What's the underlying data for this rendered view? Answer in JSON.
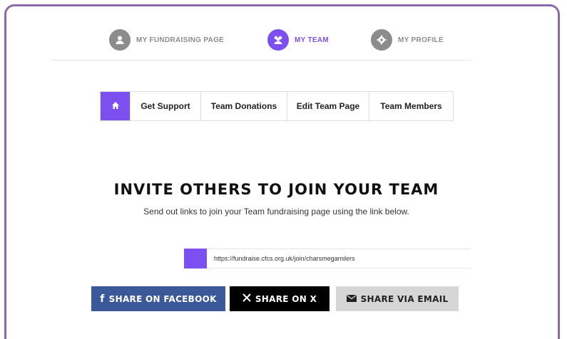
{
  "topnav": {
    "items": [
      {
        "label": "MY FUNDRAISING PAGE",
        "icon": "user-icon",
        "active": false
      },
      {
        "label": "MY TEAM",
        "icon": "team-icon",
        "active": true
      },
      {
        "label": "MY PROFILE",
        "icon": "gear-icon",
        "active": false
      }
    ]
  },
  "tabs": {
    "home_icon": "home-icon",
    "items": [
      "Get Support",
      "Team Donations",
      "Edit Team Page",
      "Team Members"
    ]
  },
  "invite": {
    "title": "INVITE OTHERS TO JOIN YOUR TEAM",
    "subtitle": "Send out links to join your Team fundraising page using the link below.",
    "link": "https://fundraise.cfcs.org.uk/join/charsmegamilers"
  },
  "share": {
    "facebook": {
      "label": "SHARE ON FACEBOOK",
      "icon": "facebook-icon",
      "color": "#3b5998"
    },
    "x": {
      "label": "SHARE ON X",
      "icon": "x-icon",
      "color": "#000000"
    },
    "email": {
      "label": "SHARE VIA EMAIL",
      "icon": "envelope-icon",
      "color": "#d6d6d6"
    }
  },
  "colors": {
    "accent": "#7b4ff0",
    "frame": "#8a6aa8",
    "inactive": "#8c8c8c"
  }
}
